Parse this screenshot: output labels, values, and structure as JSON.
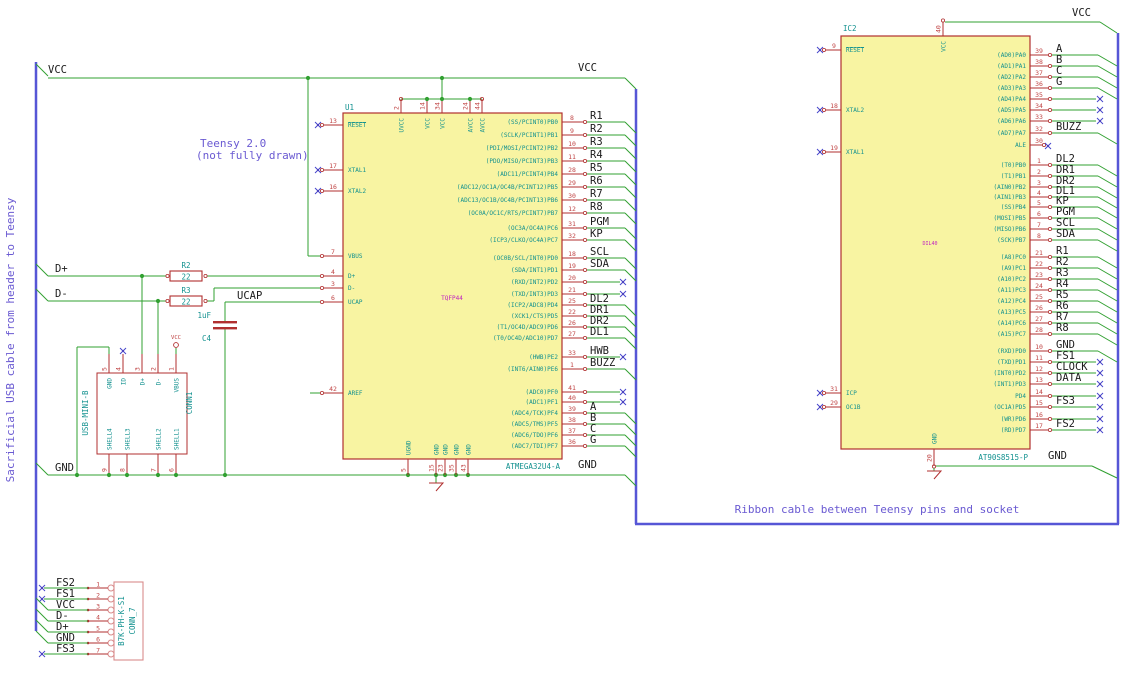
{
  "notes": {
    "left_vertical": "Sacrificial USB cable from header to Teensy",
    "teensy_line1": "Teensy 2.0",
    "teensy_line2": "(not fully drawn)",
    "ribbon": "Ribbon cable between Teensy pins and socket"
  },
  "net_labels": {
    "vcc": "VCC",
    "gnd": "GND",
    "dplus": "D+",
    "dminus": "D-",
    "ucap": "UCAP"
  },
  "colors": {
    "wire": "#31a031",
    "bus": "#5656d6",
    "outline": "#b02f2f",
    "pin_number": "#c04545",
    "pin_name": "#12918f",
    "label": "#1c1c1c",
    "no_connect": "#4545cc",
    "note": "#6a5ad2",
    "ic_fill": "#f8f4a2",
    "connector": "#d98b8b",
    "package": "#c023c0"
  },
  "components": {
    "u1": {
      "ref": "U1",
      "part": "ATMEGA32U4-A",
      "package": "TQFP44",
      "left_pins": [
        {
          "num": "13",
          "name": "RESET",
          "nc": true,
          "overline": true
        },
        {
          "num": "17",
          "name": "XTAL1",
          "nc": true
        },
        {
          "num": "16",
          "name": "XTAL2",
          "nc": true
        },
        {
          "num": "7",
          "name": "VBUS"
        },
        {
          "num": "4",
          "name": "D+"
        },
        {
          "num": "3",
          "name": "D-"
        },
        {
          "num": "6",
          "name": "UCAP"
        },
        {
          "num": "42",
          "name": "AREF"
        }
      ],
      "top_pins": [
        {
          "num": "2",
          "name": "UVCC"
        },
        {
          "num": "14",
          "name": "VCC"
        },
        {
          "num": "34",
          "name": "VCC"
        },
        {
          "num": "24",
          "name": "AVCC"
        },
        {
          "num": "44",
          "name": "AVCC"
        }
      ],
      "bottom_pins": [
        {
          "num": "5",
          "name": "UGND"
        },
        {
          "num": "15",
          "name": "GND"
        },
        {
          "num": "23",
          "name": "GND"
        },
        {
          "num": "35",
          "name": "GND"
        },
        {
          "num": "43",
          "name": "GND"
        }
      ],
      "right_pins": [
        {
          "num": "8",
          "name": "(SS/PCINT0)PB0",
          "label": "R1"
        },
        {
          "num": "9",
          "name": "(SCLK/PCINT1)PB1",
          "label": "R2"
        },
        {
          "num": "10",
          "name": "(PDI/MOSI/PCINT2)PB2",
          "label": "R3"
        },
        {
          "num": "11",
          "name": "(PDO/MISO/PCINT3)PB3",
          "label": "R4"
        },
        {
          "num": "28",
          "name": "(ADC11/PCINT4)PB4",
          "label": "R5"
        },
        {
          "num": "29",
          "name": "(ADC12/OC1A/OC4B/PCINT12)PB5",
          "label": "R6"
        },
        {
          "num": "30",
          "name": "(ADC13/OC1B/OC4B/PCINT13)PB6",
          "label": "R7"
        },
        {
          "num": "12",
          "name": "(OC0A/OC1C/RTS/PCINT7)PB7",
          "label": "R8"
        },
        {
          "num": "31",
          "name": "(OC3A/OC4A)PC6",
          "label": "PGM"
        },
        {
          "num": "32",
          "name": "(ICP3/CLKO/OC4A)PC7",
          "label": "KP"
        },
        {
          "num": "18",
          "name": "(OC0B/SCL/INT0)PD0",
          "label": "SCL"
        },
        {
          "num": "19",
          "name": "(SDA/INT1)PD1",
          "label": "SDA"
        },
        {
          "num": "20",
          "name": "(RXD/INT2)PD2",
          "nc": true
        },
        {
          "num": "21",
          "name": "(TXD/INT3)PD3",
          "nc": true
        },
        {
          "num": "25",
          "name": "(ICP2/ADC8)PD4",
          "label": "DL2"
        },
        {
          "num": "22",
          "name": "(XCK1/CTS)PD5",
          "label": "DR1"
        },
        {
          "num": "26",
          "name": "(T1/OC4D/ADC9)PD6",
          "label": "DR2"
        },
        {
          "num": "27",
          "name": "(T0/OC4D/ADC10)PD7",
          "label": "DL1"
        },
        {
          "num": "33",
          "name": "(HWB)PE2",
          "label": "HWB",
          "nc": true
        },
        {
          "num": "1",
          "name": "(INT6/AIN0)PE6",
          "label": "BUZZ"
        },
        {
          "num": "41",
          "name": "(ADC0)PF0",
          "nc": true
        },
        {
          "num": "40",
          "name": "(ADC1)PF1",
          "nc": true
        },
        {
          "num": "39",
          "name": "(ADC4/TCK)PF4",
          "label": "A"
        },
        {
          "num": "38",
          "name": "(ADC5/TMS)PF5",
          "label": "B"
        },
        {
          "num": "37",
          "name": "(ADC6/TDO)PF6",
          "label": "C"
        },
        {
          "num": "36",
          "name": "(ADC7/TDI)PF7",
          "label": "G"
        }
      ]
    },
    "ic2": {
      "ref": "IC2",
      "part": "AT90S8515-P",
      "package": "DIL40",
      "left_pins": [
        {
          "num": "9",
          "name": "RESET",
          "nc": true,
          "overline": true
        },
        {
          "num": "18",
          "name": "XTAL2",
          "nc": true
        },
        {
          "num": "19",
          "name": "XTAL1",
          "nc": true
        },
        {
          "num": "31",
          "name": "ICP",
          "nc": true
        },
        {
          "num": "29",
          "name": "OC1B",
          "nc": true
        }
      ],
      "top_pins": [
        {
          "num": "40",
          "name": "VCC"
        }
      ],
      "bottom_pins": [
        {
          "num": "20",
          "name": "GND"
        }
      ],
      "right_pins": [
        {
          "num": "39",
          "name": "(AD0)PA0",
          "label": "A"
        },
        {
          "num": "38",
          "name": "(AD1)PA1",
          "label": "B"
        },
        {
          "num": "37",
          "name": "(AD2)PA2",
          "label": "C"
        },
        {
          "num": "36",
          "name": "(AD3)PA3",
          "label": "G"
        },
        {
          "num": "35",
          "name": "(AD4)PA4",
          "nc": true
        },
        {
          "num": "34",
          "name": "(AD5)PA5",
          "nc": true
        },
        {
          "num": "33",
          "name": "(AD6)PA6",
          "nc": true
        },
        {
          "num": "32",
          "name": "(AD7)PA7",
          "label": "BUZZ"
        },
        {
          "num": "30",
          "name": "ALE",
          "nc": true,
          "nc_at_pin": true
        },
        {
          "num": "1",
          "name": "(T0)PB0",
          "label": "DL2"
        },
        {
          "num": "2",
          "name": "(T1)PB1",
          "label": "DR1"
        },
        {
          "num": "3",
          "name": "(AIN0)PB2",
          "label": "DR2"
        },
        {
          "num": "4",
          "name": "(AIN1)PB3",
          "label": "DL1"
        },
        {
          "num": "5",
          "name": "(SS)PB4",
          "label": "KP"
        },
        {
          "num": "6",
          "name": "(MOSI)PB5",
          "label": "PGM"
        },
        {
          "num": "7",
          "name": "(MISO)PB6",
          "label": "SCL"
        },
        {
          "num": "8",
          "name": "(SCK)PB7",
          "label": "SDA"
        },
        {
          "num": "21",
          "name": "(A8)PC0",
          "label": "R1"
        },
        {
          "num": "22",
          "name": "(A9)PC1",
          "label": "R2"
        },
        {
          "num": "23",
          "name": "(A10)PC2",
          "label": "R3"
        },
        {
          "num": "24",
          "name": "(A11)PC3",
          "label": "R4"
        },
        {
          "num": "25",
          "name": "(A12)PC4",
          "label": "R5"
        },
        {
          "num": "26",
          "name": "(A13)PC5",
          "label": "R6"
        },
        {
          "num": "27",
          "name": "(A14)PC6",
          "label": "R7"
        },
        {
          "num": "28",
          "name": "(A15)PC7",
          "label": "R8"
        },
        {
          "num": "10",
          "name": "(RXD)PD0",
          "label": "GND"
        },
        {
          "num": "11",
          "name": "(TXD)PD1",
          "label": "FS1",
          "nc": true
        },
        {
          "num": "12",
          "name": "(INT0)PD2",
          "label": "CLOCK",
          "nc": true
        },
        {
          "num": "13",
          "name": "(INT1)PD3",
          "label": "DATA",
          "nc": true
        },
        {
          "num": "14",
          "name": "PD4",
          "nc": true
        },
        {
          "num": "15",
          "name": "(OC1A)PD5",
          "label": "FS3",
          "nc": true
        },
        {
          "num": "16",
          "name": "(WR)PD6",
          "nc": true
        },
        {
          "num": "17",
          "name": "(RD)PD7",
          "label": "FS2",
          "nc": true
        }
      ]
    },
    "conn1": {
      "ref": "CONN1",
      "part": "USB-MINI-B",
      "top_pins": [
        {
          "num": "5",
          "name": "GND"
        },
        {
          "num": "4",
          "name": "ID",
          "nc": true
        },
        {
          "num": "3",
          "name": "D+"
        },
        {
          "num": "2",
          "name": "D-"
        },
        {
          "num": "1",
          "name": "VBUS"
        }
      ],
      "bottom_pins": [
        {
          "num": "9",
          "name": "SHELL4"
        },
        {
          "num": "8",
          "name": "SHELL3"
        },
        {
          "num": "7",
          "name": "SHELL2"
        },
        {
          "num": "6",
          "name": "SHELL1"
        }
      ]
    },
    "conn7": {
      "ref": "CONN_7",
      "part": "B7K-PH-K-S1",
      "pins": [
        {
          "num": "1",
          "label": "FS2",
          "nc": true
        },
        {
          "num": "2",
          "label": "FS1",
          "nc": true
        },
        {
          "num": "3",
          "label": "VCC"
        },
        {
          "num": "4",
          "label": "D-"
        },
        {
          "num": "5",
          "label": "D+"
        },
        {
          "num": "6",
          "label": "GND"
        },
        {
          "num": "7",
          "label": "FS3",
          "nc": true
        }
      ]
    },
    "r2": {
      "ref": "R2",
      "value": "22"
    },
    "r3": {
      "ref": "R3",
      "value": "22"
    },
    "c4": {
      "ref": "C4",
      "value": "1uF"
    }
  }
}
